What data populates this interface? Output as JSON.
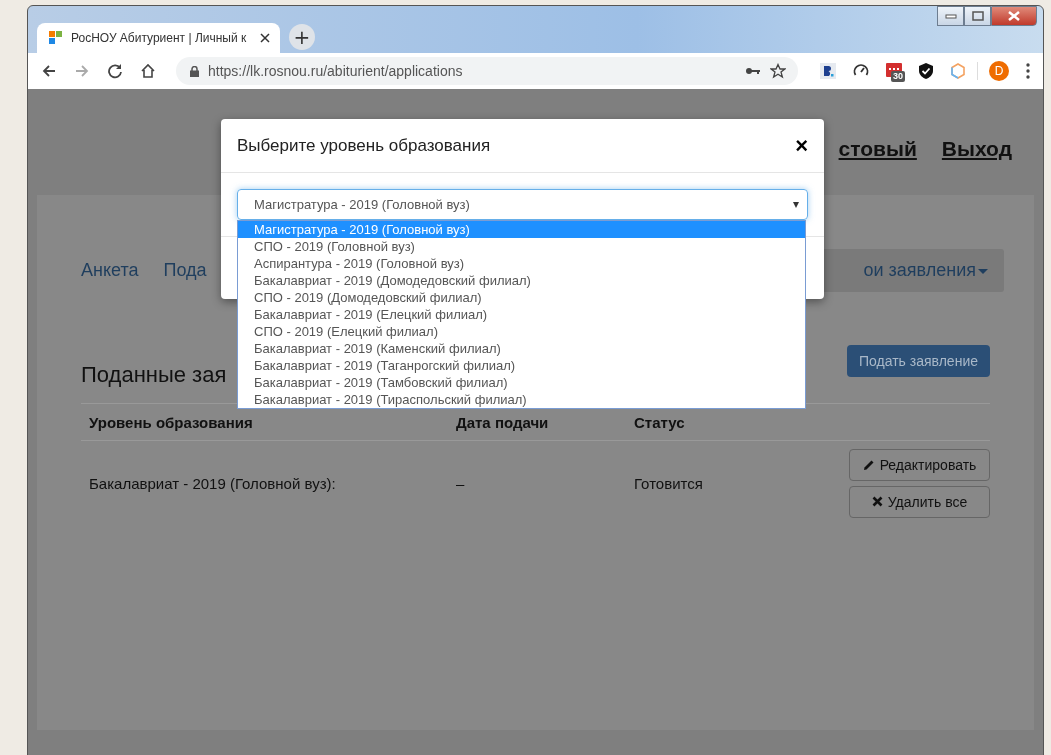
{
  "browser": {
    "tab_title": "РосНОУ Абитуриент | Личный к",
    "new_tab": "+",
    "url": "https://lk.rosnou.ru/abiturient/applications",
    "extension_badge": "30",
    "profile_initial": "D"
  },
  "page": {
    "header_links": [
      "стовый",
      "Выход"
    ],
    "nav": [
      {
        "label": "Анкета",
        "selected": false
      },
      {
        "label": "Пода",
        "selected": false
      },
      {
        "label": "ои заявления",
        "selected": true
      }
    ],
    "heading": "Поданные зая",
    "submit_button": "Подать заявление",
    "table": {
      "columns": [
        "Уровень образования",
        "Дата подачи",
        "Статус"
      ],
      "rows": [
        {
          "level": "Бакалавриат - 2019 (Головной вуз):",
          "date": "–",
          "status": "Готовится",
          "actions": [
            "Редактировать",
            "Удалить все"
          ]
        }
      ]
    }
  },
  "modal": {
    "title": "Выберите уровень образования",
    "close": "×",
    "select": {
      "value": "Магистратура - 2019 (Головной вуз)",
      "options": [
        {
          "label": "Магистратура - 2019 (Головной вуз)",
          "selected": true
        },
        {
          "label": "СПО - 2019 (Головной вуз)",
          "selected": false
        },
        {
          "label": "Аспирантура - 2019 (Головной вуз)",
          "selected": false
        },
        {
          "label": "Бакалавриат - 2019 (Домодедовский филиал)",
          "selected": false
        },
        {
          "label": "СПО - 2019 (Домодедовский филиал)",
          "selected": false
        },
        {
          "label": "Бакалавриат - 2019 (Елецкий филиал)",
          "selected": false
        },
        {
          "label": "СПО - 2019 (Елецкий филиал)",
          "selected": false
        },
        {
          "label": "Бакалавриат - 2019 (Каменский филиал)",
          "selected": false
        },
        {
          "label": "Бакалавриат - 2019 (Таганрогский филиал)",
          "selected": false
        },
        {
          "label": "Бакалавриат - 2019 (Тамбовский филиал)",
          "selected": false
        },
        {
          "label": "Бакалавриат - 2019 (Тираспольский филиал)",
          "selected": false
        }
      ]
    }
  }
}
